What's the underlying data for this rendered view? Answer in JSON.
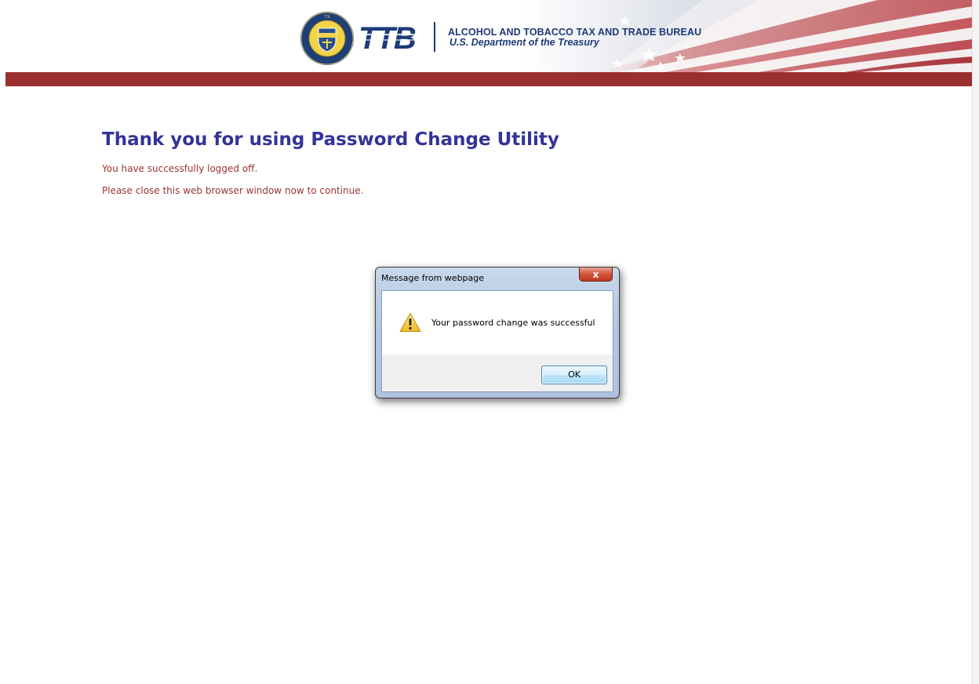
{
  "header": {
    "agency_name": "ALCOHOL AND TOBACCO TAX AND TRADE BUREAU",
    "department": "U.S. Department of the Treasury",
    "logo_text": "TTB",
    "seal_text": "ALCOHOL AND TOBACCO TAX AND TRADE BUREAU",
    "accent_color": "#9b2f30",
    "brand_color": "#1d3a78"
  },
  "main": {
    "heading": "Thank you for using Password Change Utility",
    "message_logged_off": "You have successfully logged off.",
    "message_close": "Please close this web browser window now to continue.",
    "heading_color": "#333399",
    "message_color": "#993333"
  },
  "dialog": {
    "title": "Message from webpage",
    "close_label": "x",
    "icon": "warning-icon",
    "message": "Your password change was successful",
    "ok_label": "OK"
  }
}
